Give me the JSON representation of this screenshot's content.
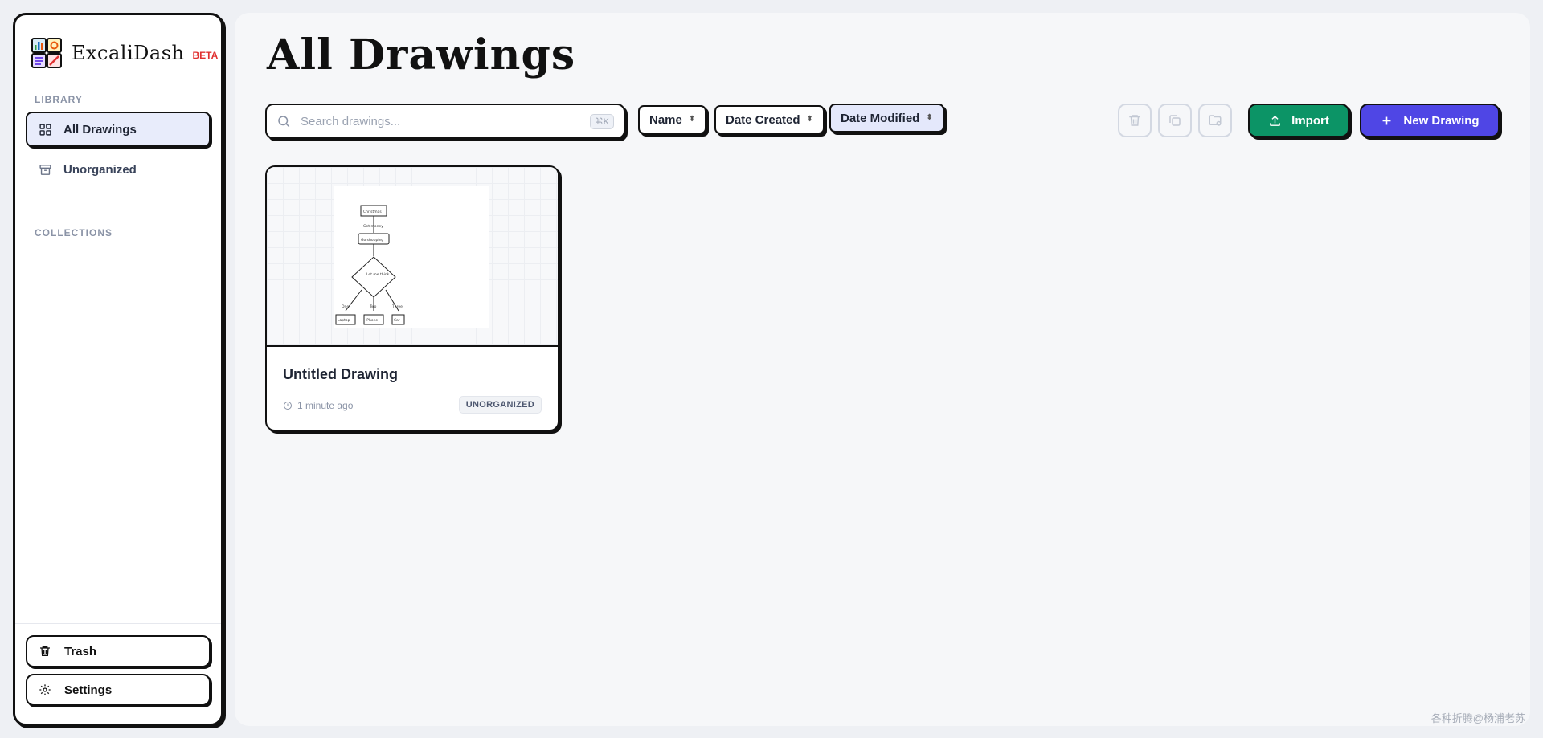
{
  "brand": {
    "name": "ExcaliDash",
    "badge": "BETA"
  },
  "sidebar": {
    "library_label": "LIBRARY",
    "items": [
      {
        "label": "All Drawings",
        "icon": "grid-icon",
        "active": true
      },
      {
        "label": "Unorganized",
        "icon": "archive-icon",
        "active": false
      }
    ],
    "collections_label": "COLLECTIONS",
    "footer": [
      {
        "label": "Trash",
        "icon": "trash-icon"
      },
      {
        "label": "Settings",
        "icon": "gear-icon"
      }
    ]
  },
  "main": {
    "title": "All Drawings",
    "search": {
      "placeholder": "Search drawings...",
      "shortcut": "⌘K"
    },
    "sort": [
      {
        "label": "Name",
        "active": false
      },
      {
        "label": "Date Created",
        "active": false
      },
      {
        "label": "Date Modified",
        "active": true
      }
    ],
    "actions": {
      "import_label": "Import",
      "new_label": "New Drawing"
    }
  },
  "drawings": [
    {
      "title": "Untitled Drawing",
      "modified": "1 minute ago",
      "collection": "UNORGANIZED",
      "thumbnail_text": [
        "Christmas",
        "Get money",
        "Go shopping",
        "Let me think",
        "One",
        "Two",
        "Three",
        "Laptop",
        "iPhone",
        "Car"
      ]
    }
  ],
  "watermark": "各种折腾@杨浦老苏",
  "colors": {
    "accent": "#4f46e5",
    "import": "#0c9466",
    "beta": "#e03131",
    "active_nav": "#e8ecfb"
  }
}
